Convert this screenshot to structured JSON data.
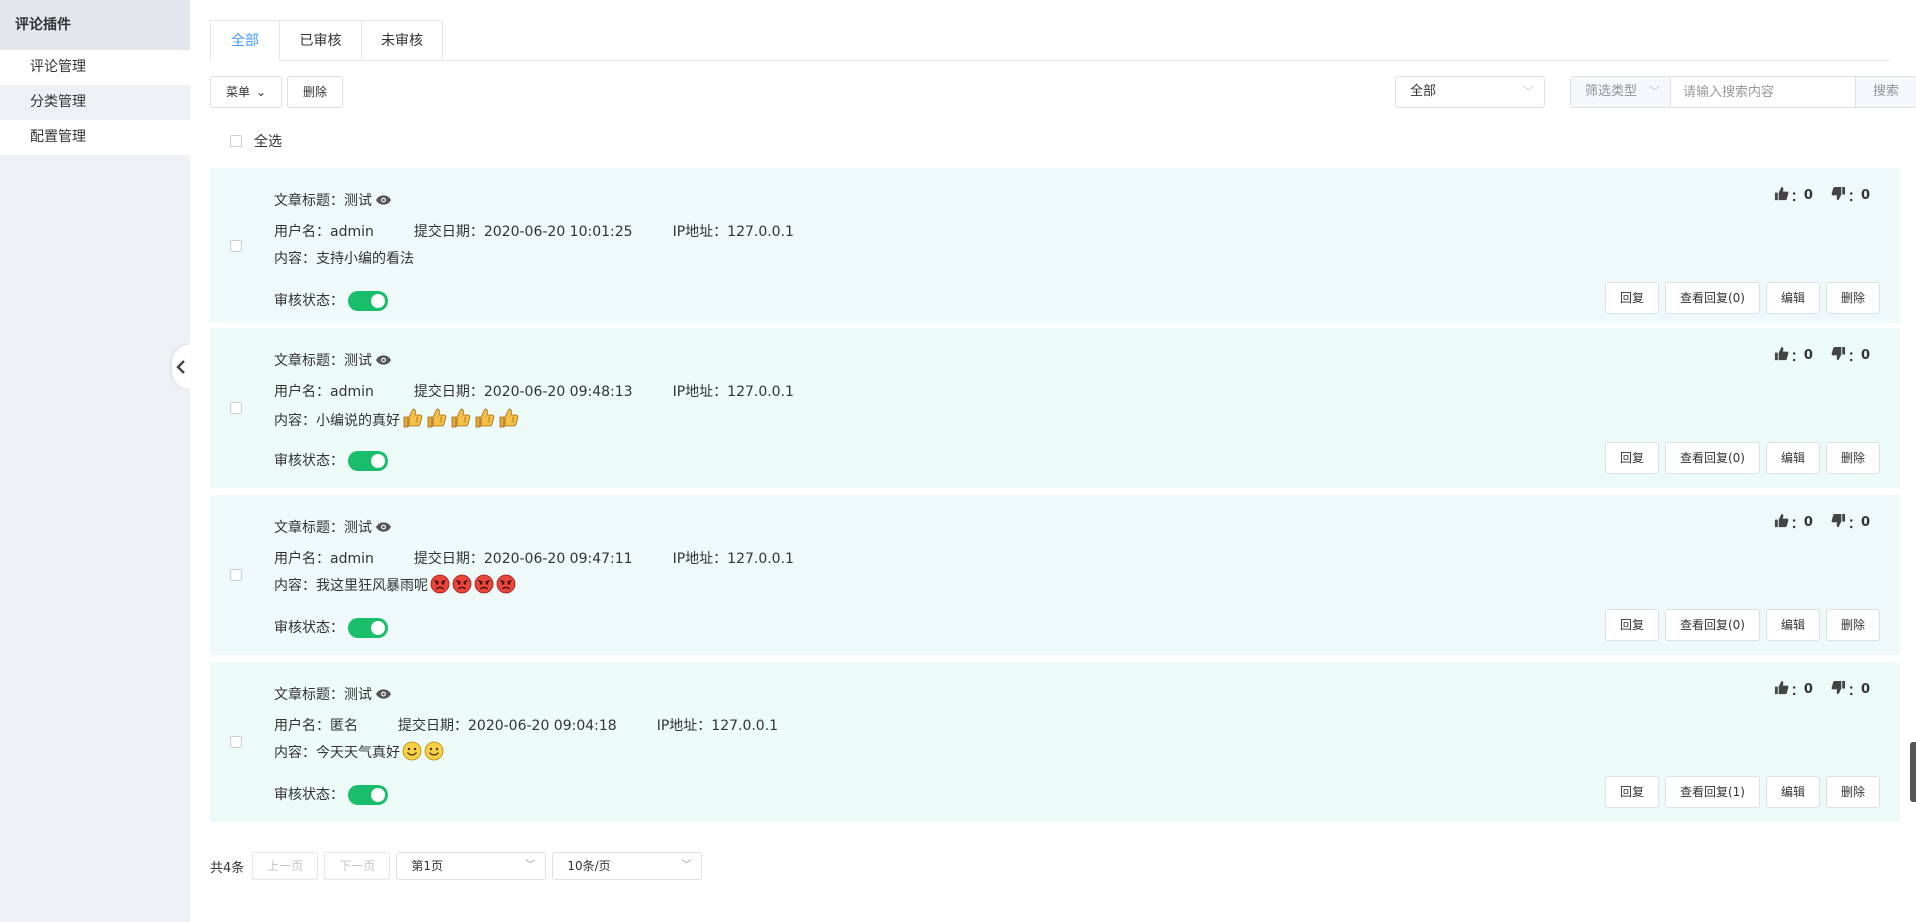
{
  "sidebar": {
    "title": "评论插件",
    "items": [
      {
        "label": "评论管理"
      },
      {
        "label": "分类管理"
      },
      {
        "label": "配置管理"
      }
    ]
  },
  "tabs": [
    {
      "label": "全部",
      "active": true
    },
    {
      "label": "已审核",
      "active": false
    },
    {
      "label": "未审核",
      "active": false
    }
  ],
  "toolbar": {
    "menu_label": "菜单",
    "delete_label": "删除",
    "category_select_value": "全部",
    "filter_type_label": "筛选类型",
    "search_placeholder": "请输入搜索内容",
    "search_button": "搜索"
  },
  "select_all_label": "全选",
  "labels": {
    "article_title": "文章标题：",
    "username": "用户名：",
    "submit_date": "提交日期：",
    "ip": "IP地址：",
    "content": "内容：",
    "status": "审核状态：",
    "likes_sep": "：",
    "reply": "回复",
    "view_replies_prefix": "查看回复",
    "edit": "编辑",
    "delete": "删除"
  },
  "comments": [
    {
      "article": "测试",
      "username": "admin",
      "date": "2020-06-20 10:01:25",
      "ip": "127.0.0.1",
      "content": "支持小编的看法",
      "emoji": "",
      "emoji_count": 0,
      "likes": "0",
      "dislikes": "0",
      "approved": true,
      "replies": "(0)",
      "bg": "#f0f9fa"
    },
    {
      "article": "测试",
      "username": "admin",
      "date": "2020-06-20 09:48:13",
      "ip": "127.0.0.1",
      "content": "小编说的真好",
      "emoji": "thumbs-up-emoji",
      "emoji_count": 5,
      "likes": "0",
      "dislikes": "0",
      "approved": true,
      "replies": "(0)",
      "bg": "#edfbf8"
    },
    {
      "article": "测试",
      "username": "admin",
      "date": "2020-06-20 09:47:11",
      "ip": "127.0.0.1",
      "content": "我这里狂风暴雨呢",
      "emoji": "angry-face-emoji",
      "emoji_count": 4,
      "likes": "0",
      "dislikes": "0",
      "approved": true,
      "replies": "(0)",
      "bg": "#f0f9fa"
    },
    {
      "article": "测试",
      "username": "匿名",
      "date": "2020-06-20 09:04:18",
      "ip": "127.0.0.1",
      "content": "今天天气真好",
      "emoji": "smiley-face-emoji",
      "emoji_count": 2,
      "likes": "0",
      "dislikes": "0",
      "approved": true,
      "replies": "(1)",
      "bg": "#edfbf8"
    }
  ],
  "pagination": {
    "total": "共4条",
    "prev": "上一页",
    "next": "下一页",
    "page_select": "第1页",
    "page_size_select": "10条/页"
  },
  "colors": {
    "accent": "#409eff",
    "toggle_on": "#19be6b",
    "sidebar_bg": "#eef0f5"
  }
}
